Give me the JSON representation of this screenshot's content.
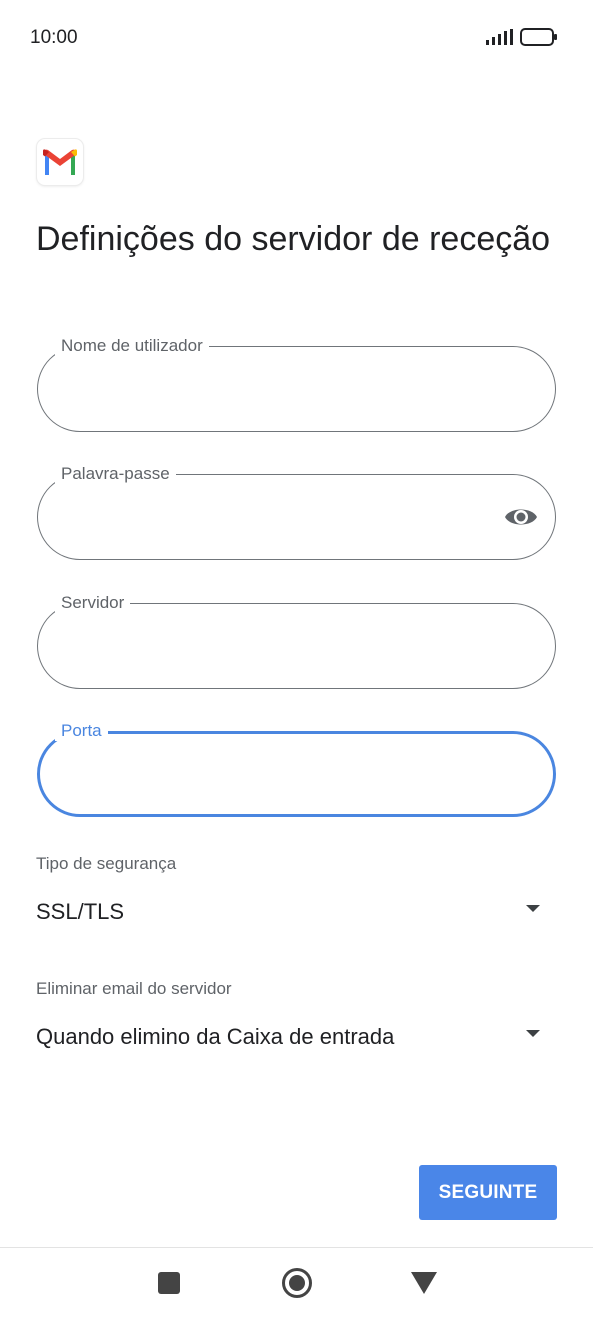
{
  "status_bar": {
    "time": "10:00"
  },
  "app": {
    "logo": "gmail-logo"
  },
  "page": {
    "title": "Definições do servidor de receção"
  },
  "form": {
    "username": {
      "label": "Nome de utilizador",
      "value": ""
    },
    "password": {
      "label": "Palavra-passe",
      "value": ""
    },
    "server": {
      "label": "Servidor",
      "value": ""
    },
    "port": {
      "label": "Porta",
      "value": ""
    },
    "security": {
      "label": "Tipo de segurança",
      "value": "SSL/TLS"
    },
    "delete_email": {
      "label": "Eliminar email do servidor",
      "value": "Quando elimino da Caixa de entrada"
    }
  },
  "actions": {
    "next_label": "SEGUINTE"
  },
  "colors": {
    "accent": "#4a86e8",
    "focus": "#4a86e0",
    "outline": "#70757a"
  },
  "icons": [
    "signal-icon",
    "battery-icon",
    "eye-icon",
    "dropdown-caret-icon",
    "nav-recent-icon",
    "nav-home-icon",
    "nav-back-icon"
  ]
}
